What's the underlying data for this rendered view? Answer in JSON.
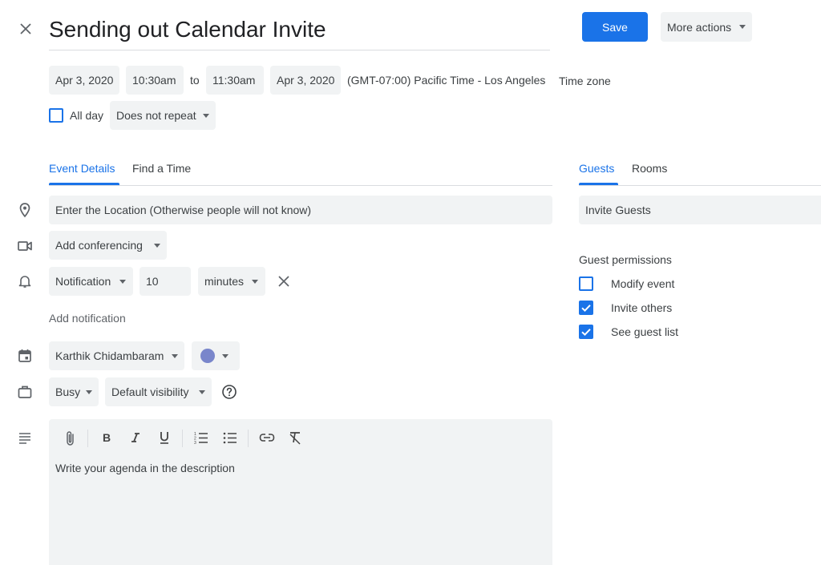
{
  "header": {
    "title": "Sending out Calendar Invite",
    "save_label": "Save",
    "more_actions_label": "More actions"
  },
  "datetime": {
    "start_date": "Apr 3, 2020",
    "start_time": "10:30am",
    "to_label": "to",
    "end_time": "11:30am",
    "end_date": "Apr 3, 2020",
    "timezone_display": "(GMT-07:00) Pacific Time - Los Angeles",
    "timezone_link": "Time zone",
    "all_day_label": "All day",
    "all_day_checked": false,
    "repeat_value": "Does not repeat"
  },
  "tabs": {
    "event_details": "Event Details",
    "find_time": "Find a Time",
    "active": "event_details"
  },
  "details": {
    "location_value": "Enter the Location (Otherwise people will not know)",
    "conferencing_label": "Add conferencing",
    "notification_type": "Notification",
    "notification_amount": "10",
    "notification_unit": "minutes",
    "add_notification_label": "Add notification",
    "calendar_owner": "Karthik Chidambaram",
    "calendar_color": "#7986cb",
    "busy_value": "Busy",
    "visibility_value": "Default visibility",
    "description_text": "Write your agenda in the description"
  },
  "toolbar": {
    "icons": [
      "attachment-icon",
      "bold-icon",
      "italic-icon",
      "underline-icon",
      "numbered-list-icon",
      "bulleted-list-icon",
      "link-icon",
      "clear-formatting-icon"
    ]
  },
  "side": {
    "guests_tab": "Guests",
    "rooms_tab": "Rooms",
    "invite_guests_value": "Invite Guests",
    "permissions_heading": "Guest permissions",
    "permissions": [
      {
        "label": "Modify event",
        "checked": false
      },
      {
        "label": "Invite others",
        "checked": true
      },
      {
        "label": "See guest list",
        "checked": true
      }
    ]
  },
  "colors": {
    "accent": "#1a73e8",
    "field_bg": "#f1f3f4",
    "text": "#3c4043",
    "icon": "#5f6368"
  }
}
